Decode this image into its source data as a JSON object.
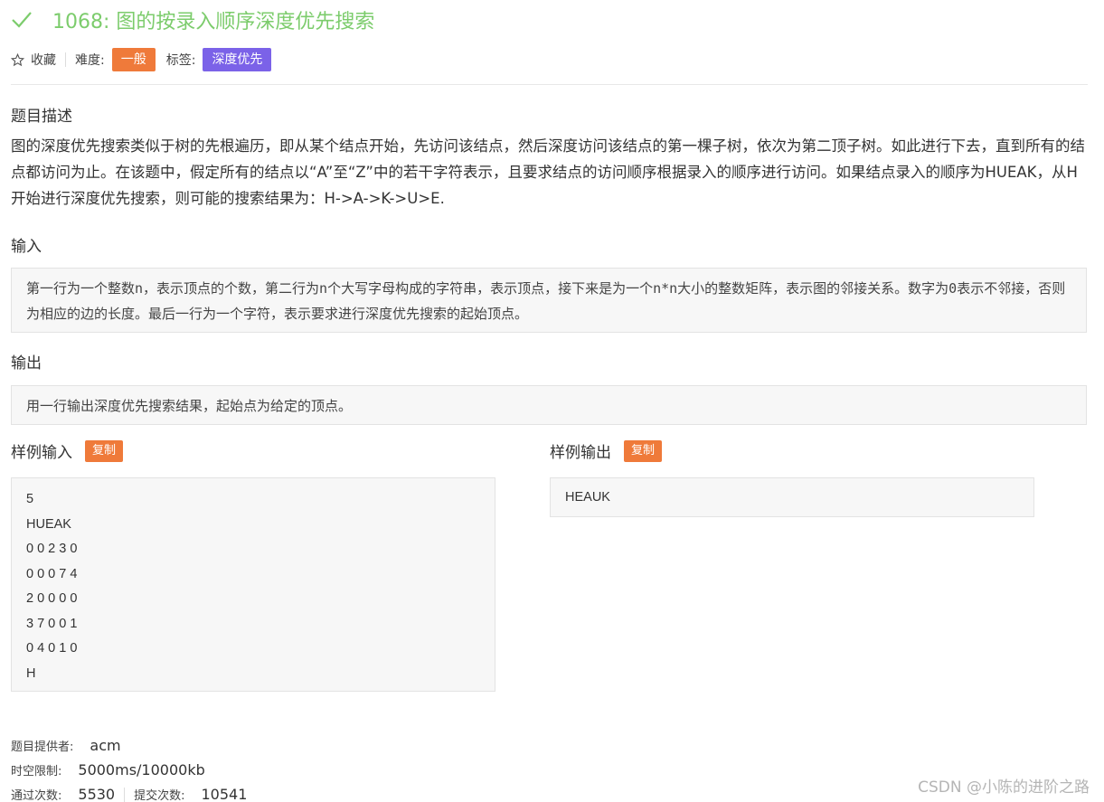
{
  "problem": {
    "title": "1068: 图的按录入顺序深度优先搜索",
    "favorite_label": "收藏",
    "difficulty_label": "难度:",
    "difficulty_value": "一般",
    "tags_label": "标签:",
    "tag_value": "深度优先"
  },
  "description": {
    "heading": "题目描述",
    "text": "图的深度优先搜索类似于树的先根遍历，即从某个结点开始，先访问该结点，然后深度访问该结点的第一棵子树，依次为第二顶子树。如此进行下去，直到所有的结点都访问为止。在该题中，假定所有的结点以“A”至“Z”中的若干字符表示，且要求结点的访问顺序根据录入的顺序进行访问。如果结点录入的顺序为HUEAK，从H开始进行深度优先搜索，则可能的搜索结果为：H->A->K->U>E."
  },
  "input": {
    "heading": "输入",
    "text": "第一行为一个整数n，表示顶点的个数，第二行为n个大写字母构成的字符串，表示顶点，接下来是为一个n*n大小的整数矩阵，表示图的邻接关系。数字为0表示不邻接，否则为相应的边的长度。最后一行为一个字符，表示要求进行深度优先搜索的起始顶点。"
  },
  "output": {
    "heading": "输出",
    "text": "用一行输出深度优先搜索结果，起始点为给定的顶点。"
  },
  "sample_input": {
    "heading": "样例输入",
    "copy_label": "复制",
    "lines": [
      "5",
      "HUEAK",
      "0 0 2 3 0",
      "0 0 0 7 4",
      "2 0 0 0 0",
      "3 7 0 0 1",
      "0 4 0 1 0",
      "H"
    ]
  },
  "sample_output": {
    "heading": "样例输出",
    "copy_label": "复制",
    "lines": [
      "HEAUK"
    ]
  },
  "footer": {
    "provider_label": "题目提供者:",
    "provider_value": "acm",
    "limit_label": "时空限制:",
    "limit_value": "5000ms/10000kb",
    "pass_label": "通过次数:",
    "pass_value": "5530",
    "submit_label": "提交次数:",
    "submit_value": "10541"
  },
  "watermark": "CSDN @小陈的进阶之路",
  "colors": {
    "title_green": "#7ccc6c",
    "badge_orange": "#ef7a3a",
    "badge_purple": "#7b62e8"
  }
}
